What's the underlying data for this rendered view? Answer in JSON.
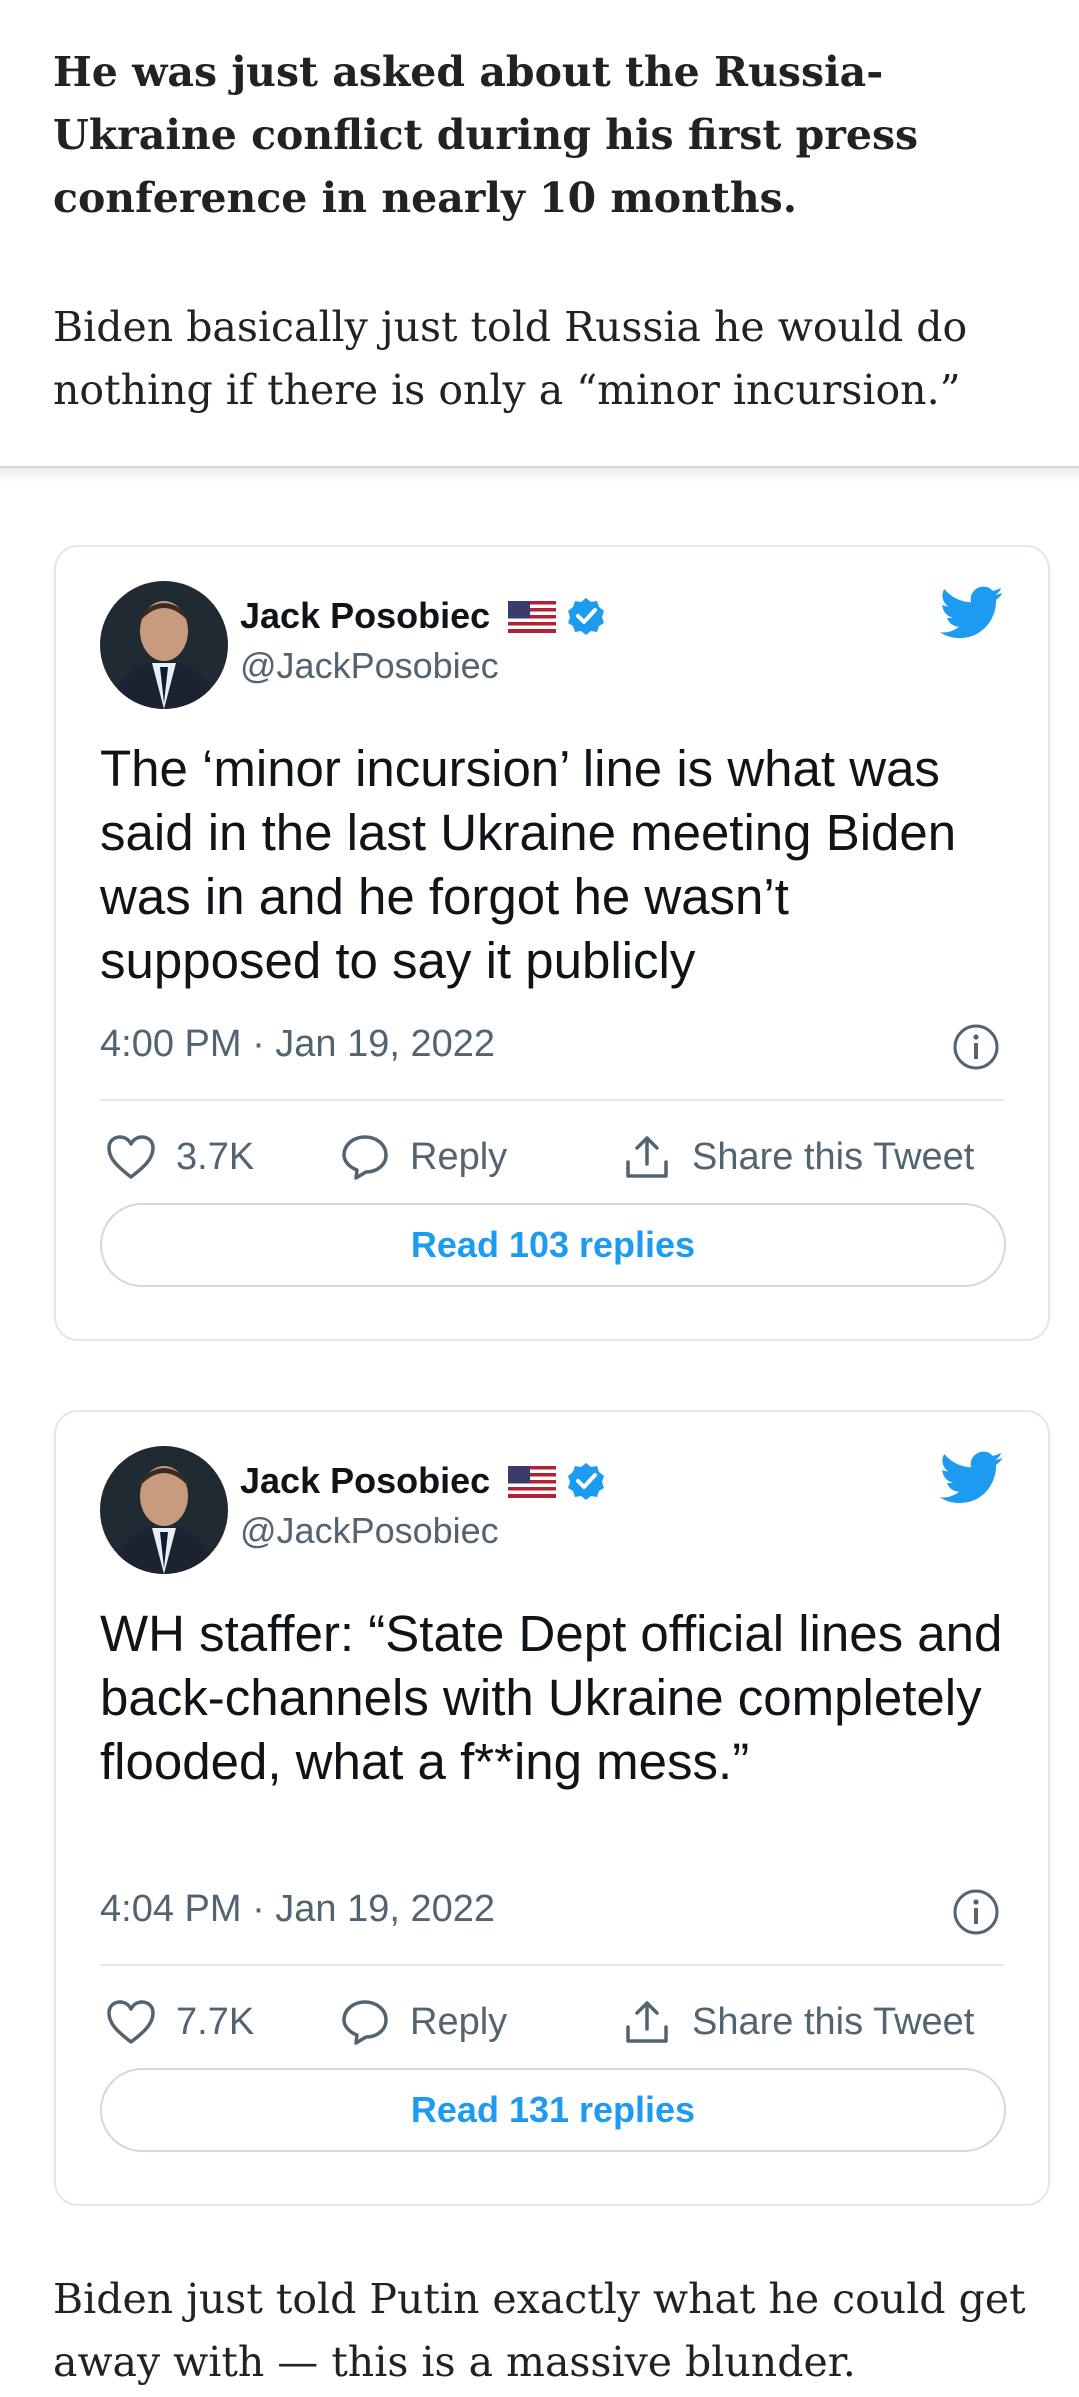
{
  "article": {
    "para_1": "He was just asked about the Russia-Ukraine conflict during his first press conference in nearly 10 months.",
    "para_2": "Biden basically just told Russia he would do nothing if there is only a “minor incursion.”",
    "para_3": "Biden just told Putin exactly what he could get away with — this is a massive blunder."
  },
  "tweets": [
    {
      "author_name": "Jack Posobiec",
      "handle": "@JackPosobiec",
      "text": "The ‘minor incursion’ line is what was said in the last Ukraine meeting Biden was in and he forgot he wasn’t supposed to say it publicly",
      "timestamp": "4:00 PM · Jan 19, 2022",
      "likes": "3.7K",
      "reply_label": "Reply",
      "share_label": "Share this Tweet",
      "read_replies": "Read 103 replies"
    },
    {
      "author_name": "Jack Posobiec",
      "handle": "@JackPosobiec",
      "text": "WH staffer: “State Dept official lines and back-channels with Ukraine completely flooded, what a f**ing mess.”",
      "timestamp": "4:04 PM · Jan 19, 2022",
      "likes": "7.7K",
      "reply_label": "Reply",
      "share_label": "Share this Tweet",
      "read_replies": "Read 131 replies"
    }
  ],
  "icons": {
    "brand": "twitter-bird-icon",
    "flag": "us-flag-icon",
    "verified": "verified-badge-icon",
    "like": "heart-icon",
    "reply": "speech-bubble-icon",
    "share": "share-arrow-icon",
    "info": "info-icon"
  },
  "colors": {
    "twitter_blue": "#1d9bf0",
    "text_primary": "#0f1419",
    "text_secondary": "#536471",
    "border": "#e1e8ed"
  }
}
